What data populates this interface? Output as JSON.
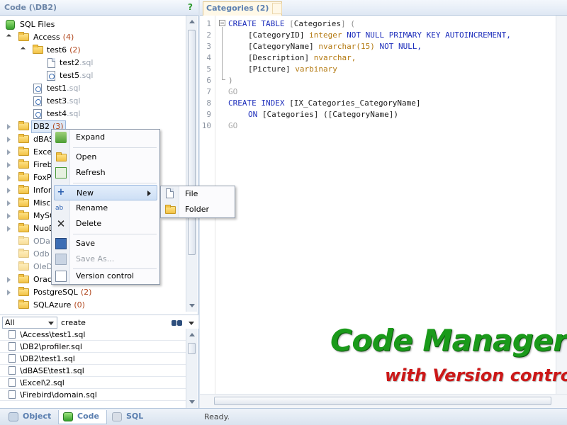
{
  "left_panel": {
    "title": "Code (\\DB2)",
    "help": "?"
  },
  "tree": {
    "root": "SQL Files",
    "access": {
      "label": "Access",
      "count": "(4)"
    },
    "test6": {
      "label": "test6",
      "count": "(2)"
    },
    "test2": {
      "label": "test2",
      "ext": ".sql"
    },
    "test5": {
      "label": "test5",
      "ext": ".sql"
    },
    "test1": {
      "label": "test1",
      "ext": ".sql"
    },
    "test3": {
      "label": "test3",
      "ext": ".sql"
    },
    "test4": {
      "label": "test4",
      "ext": ".sql"
    },
    "db2": {
      "label": "DB2",
      "count": "(3)"
    },
    "folders": [
      "dBASE",
      "Excel",
      "Firebird",
      "FoxPro",
      "Informix",
      "Misc",
      "MySQL",
      "NuoDB"
    ],
    "dim_folders": [
      "ODa",
      "Odb",
      "OleD"
    ],
    "oracle": "Oracle",
    "postgres": {
      "label": "PostgreSQL",
      "count": "(2)"
    },
    "sqlazure": {
      "label": "SQLAzure",
      "count": "(0)"
    }
  },
  "search": {
    "filter": "All",
    "query": "create"
  },
  "results": [
    "\\Access\\test1.sql",
    "\\DB2\\profiler.sql",
    "\\DB2\\test1.sql",
    "\\dBASE\\test1.sql",
    "\\Excel\\2.sql",
    "\\Firebird\\domain.sql"
  ],
  "context_menu": {
    "expand": "Expand",
    "open": "Open",
    "refresh": "Refresh",
    "new": "New",
    "rename": "Rename",
    "delete": "Delete",
    "save": "Save",
    "save_as": "Save As...",
    "version_control": "Version control"
  },
  "submenu": {
    "file": "File",
    "folder": "Folder"
  },
  "editor": {
    "tab_label": "Categories (2)",
    "tab_close": "×",
    "line_numbers": [
      "1",
      "2",
      "3",
      "4",
      "5",
      "6",
      "7",
      "8",
      "9",
      "10"
    ],
    "code": {
      "l1_kw": "CREATE TABLE",
      "l1_open": "[",
      "l1_name": "Categories",
      "l1_close": "] (",
      "l2_name": "[CategoryID]",
      "l2_type": "integer",
      "l2_kw": "NOT NULL PRIMARY KEY AUTOINCREMENT,",
      "l3_name": "[CategoryName]",
      "l3_type": "nvarchar(15)",
      "l3_kw": "NOT NULL,",
      "l4_name": "[Description]",
      "l4_type": "nvarchar,",
      "l5_name": "[Picture]",
      "l5_type": "varbinary",
      "l6": ")",
      "go1": "GO",
      "l8_kw": "CREATE INDEX",
      "l8_name": "[IX_Categories_CategoryName]",
      "l9_kw": "ON",
      "l9_name": "[Categories]",
      "l9_col": "([CategoryName])",
      "go2": "GO"
    }
  },
  "bottom_tabs": {
    "object": "Object",
    "code": "Code",
    "sql": "SQL"
  },
  "status": "Ready.",
  "promo": {
    "title": "Code Manager",
    "subtitle": "with Version control"
  },
  "colors": {
    "accent_blue": "#5b7fb0",
    "promo_green": "#1a9a1a",
    "promo_red": "#cc1818"
  }
}
